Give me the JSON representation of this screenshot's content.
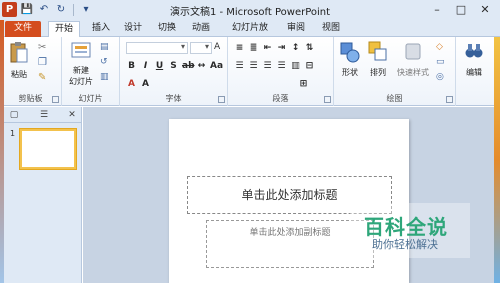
{
  "window": {
    "title": "演示文稿1 - Microsoft PowerPoint",
    "app_logo": "P"
  },
  "qat": {
    "save_icon": "save-icon",
    "undo_icon": "undo-icon",
    "redo_icon": "redo-icon"
  },
  "tabs": [
    "文件",
    "开始",
    "插入",
    "设计",
    "切换",
    "动画",
    "幻灯片放映",
    "审阅",
    "视图"
  ],
  "ribbon": {
    "clipboard": {
      "paste": "粘贴",
      "label": "剪贴板"
    },
    "slides": {
      "new_slide_line1": "新建",
      "new_slide_line2": "幻灯片",
      "label": "幻灯片"
    },
    "font": {
      "label": "字体"
    },
    "paragraph": {
      "label": "段落"
    },
    "drawing": {
      "shape": "形状",
      "arrange": "排列",
      "quick_styles": "快速样式",
      "label": "绘图"
    },
    "editing": {
      "edit": "编辑"
    }
  },
  "slide_pane": {
    "slide_number": "1"
  },
  "slide": {
    "title_placeholder": "单击此处添加标题",
    "subtitle_placeholder": "单击此处添加副标题"
  },
  "watermark": {
    "title": "百科全说",
    "subtitle": "助你轻松解决"
  },
  "colors": {
    "file_tab": "#d44d1e",
    "ribbon_bg": "#dfe9f5",
    "thumb_border": "#f3c24d",
    "watermark_green": "#2ea67a"
  }
}
